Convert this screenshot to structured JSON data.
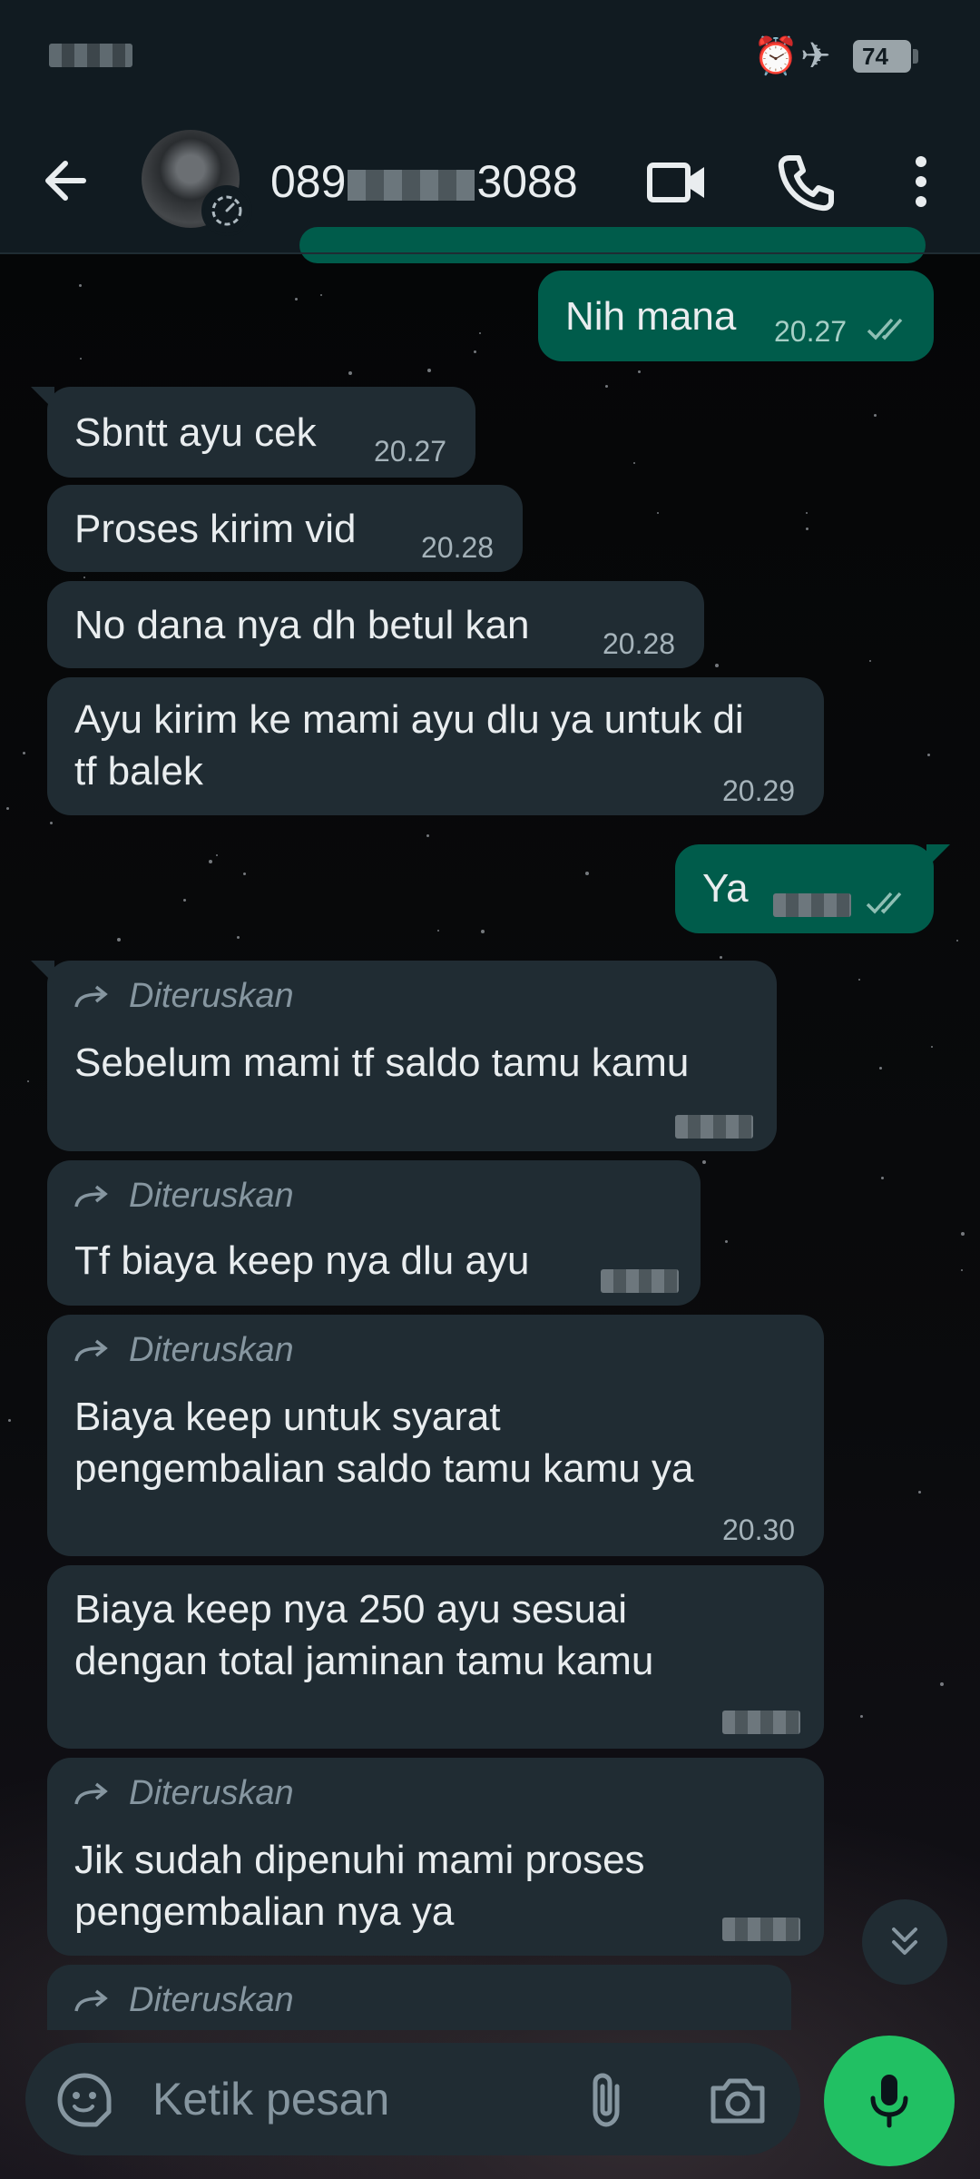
{
  "header": {
    "contact_prefix": "089",
    "contact_suffix": "3088"
  },
  "status": {
    "battery": "74"
  },
  "messages": [
    {
      "text": "Nih mana",
      "time": "20.27"
    },
    {
      "text": "Sbntt ayu cek",
      "time": "20.27"
    },
    {
      "text": "Proses kirim vid",
      "time": "20.28"
    },
    {
      "text": "No dana nya dh betul kan",
      "time": "20.28"
    },
    {
      "text": "Ayu kirim ke mami ayu dlu ya untuk di\ntf balek",
      "time": "20.29"
    },
    {
      "text": "Ya"
    },
    {
      "forward": "Diteruskan",
      "text": "Sebelum mami tf saldo tamu kamu"
    },
    {
      "forward": "Diteruskan",
      "text": "Tf biaya keep nya dlu ayu"
    },
    {
      "forward": "Diteruskan",
      "text": "Biaya keep untuk syarat\npengembalian saldo tamu kamu ya",
      "time": "20.30"
    },
    {
      "text": "Biaya keep nya 250 ayu sesuai\ndengan total jaminan tamu kamu"
    },
    {
      "forward": "Diteruskan",
      "text": "Jik sudah dipenuhi mami proses\npengembalian nya ya"
    },
    {
      "forward": "Diteruskan"
    }
  ],
  "input": {
    "placeholder": "Ketik pesan"
  },
  "icons": [
    "back-arrow-icon",
    "video-call-icon",
    "phone-icon",
    "more-options-icon",
    "alarm-icon",
    "airplane-mode-icon",
    "emoji-sticker-icon",
    "attach-icon",
    "camera-icon",
    "mic-icon",
    "scroll-down-icon",
    "read-ticks-icon",
    "forward-arrow-icon"
  ],
  "colors": {
    "incoming": "#202c33",
    "outgoing": "#005c4b",
    "accent": "#21c063",
    "header": "#111b21"
  }
}
